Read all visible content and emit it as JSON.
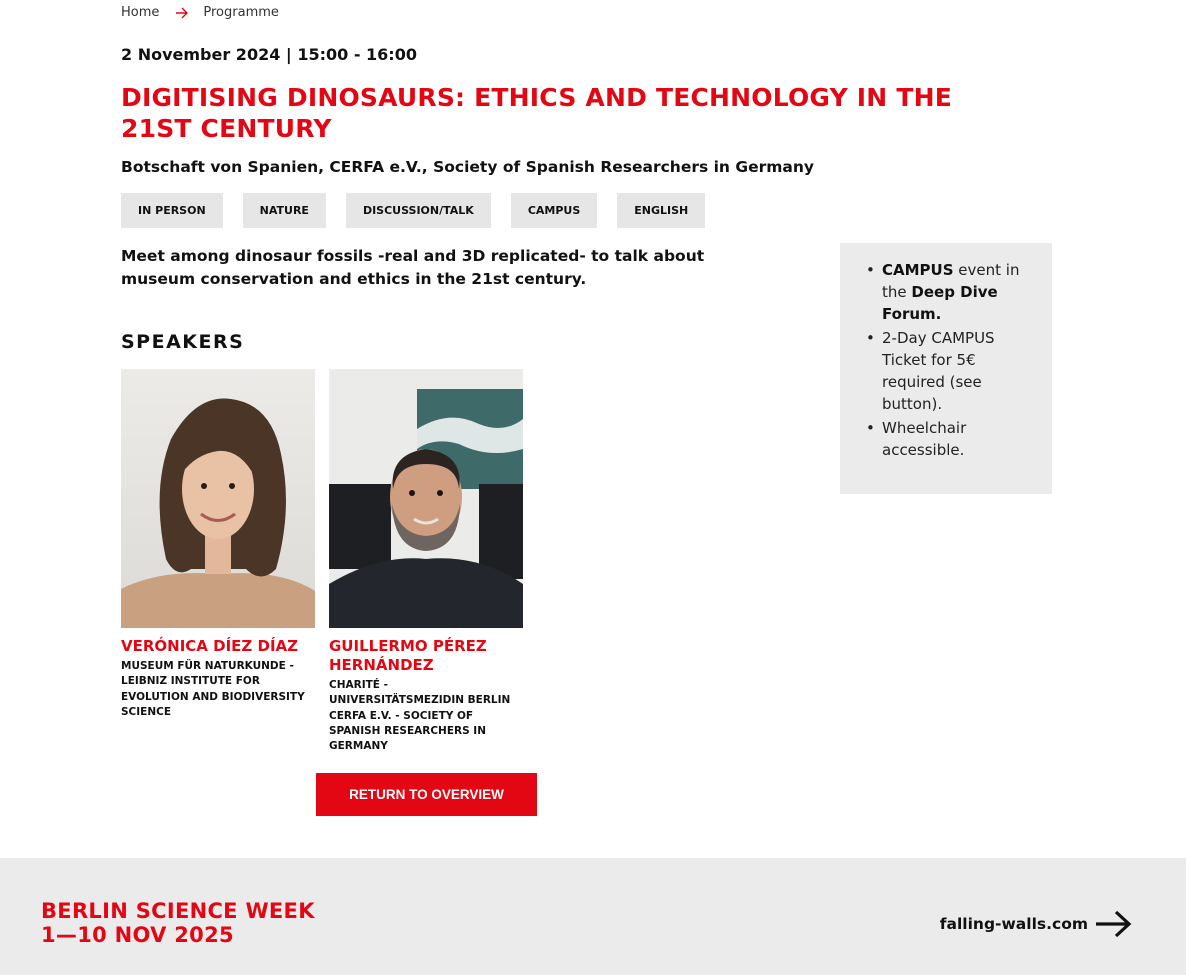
{
  "breadcrumb": {
    "home": "Home",
    "current": "Programme"
  },
  "event": {
    "datetime": "2 November 2024 | 15:00 - 16:00",
    "title": "DIGITISING DINOSAURS: ETHICS AND TECHNOLOGY IN THE 21ST CENTURY",
    "organizers": "Botschaft von Spanien, CERFA e.V., Society of Spanish Researchers in Germany",
    "tags": [
      "IN PERSON",
      "NATURE",
      "DISCUSSION/TALK",
      "CAMPUS",
      "ENGLISH"
    ],
    "intro": "Meet among dinosaur fossils -real and 3D replicated- to talk about museum conservation and ethics in the 21st century."
  },
  "speakers": {
    "heading": "SPEAKERS",
    "items": [
      {
        "name": "VERÓNICA DÍEZ DÍAZ",
        "affiliation": "MUSEUM FÜR NATURKUNDE - LEIBNIZ INSTITUTE FOR EVOLUTION AND BIODIVERSITY SCIENCE"
      },
      {
        "name": "GUILLERMO PÉREZ HERNÁNDEZ",
        "affiliation_1": "CHARITÉ - UNIVERSITÄTSMEZIDIN BERLIN",
        "affiliation_2": "CERFA E.V. - SOCIETY OF SPANISH RESEARCHERS IN GERMANY"
      }
    ]
  },
  "return_button": "RETURN TO OVERVIEW",
  "info_box": {
    "item1_bold1": "CAMPUS",
    "item1_text": " event in the ",
    "item1_bold2": "Deep Dive Forum.",
    "item2": "2-Day CAMPUS Ticket for 5€ required (see button).",
    "item3": "Wheelchair accessible."
  },
  "footer": {
    "logo_line1": "BERLIN SCIENCE WEEK",
    "logo_line2": "1—10 NOV 2025",
    "link": "falling-walls.com"
  },
  "colors": {
    "accent": "#e30613",
    "tag_bg": "#e6e6e6",
    "panel_bg": "#ebebeb"
  },
  "icons": {
    "breadcrumb_separator": "arrow-right-icon",
    "footer_link": "arrow-right-icon"
  }
}
